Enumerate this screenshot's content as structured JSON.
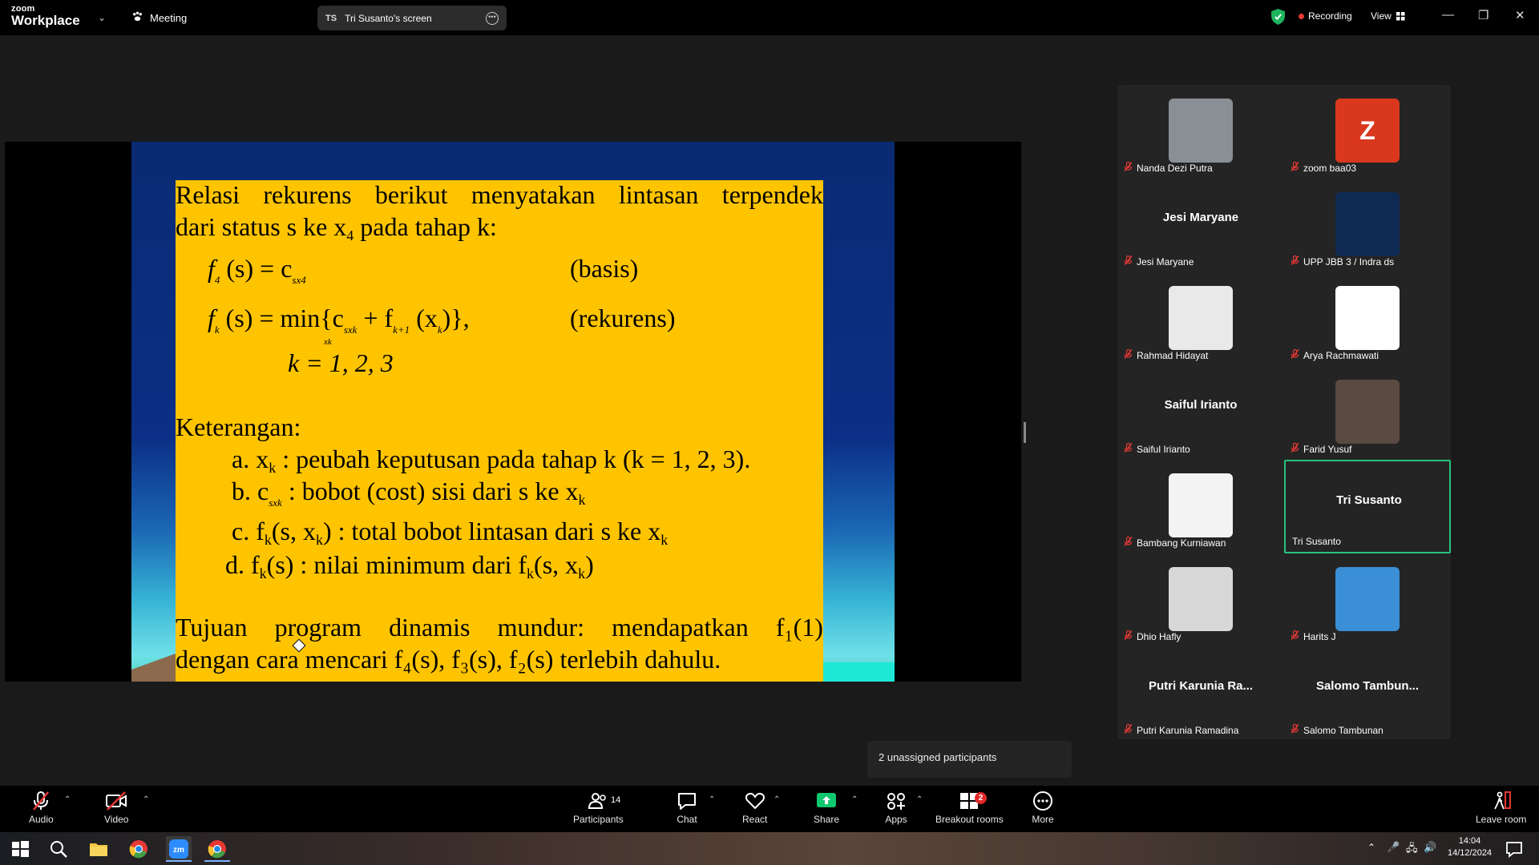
{
  "app": {
    "logo_top": "zoom",
    "logo_bottom": "Workplace",
    "meeting_label": "Meeting"
  },
  "screen_share": {
    "initials": "TS",
    "label": "Tri Susanto's screen"
  },
  "status": {
    "recording": "Recording",
    "view": "View"
  },
  "slide": {
    "line1": [
      "Relasi",
      "rekurens",
      "berikut",
      "menyatakan",
      "lintasan",
      "terpendek"
    ],
    "line2": "dari status s ke x",
    "line2_sub": "4",
    "line2_end": " pada tahap k:",
    "eq1": "f",
    "eq1_sub": "4",
    "eq1_rest": " (s) = c",
    "eq1_csub": "sx4",
    "basis": "(basis)",
    "eq2_a": "f",
    "eq2_ksub": "k",
    "eq2_b": " (s) = min{c",
    "eq2_csub": "sxk",
    "eq2_c": " + f",
    "eq2_fsub": "k+1",
    "eq2_d": " (x",
    "eq2_xsub": "k",
    "eq2_e": ")},",
    "eq2_min_sub": "xk",
    "rekurens": "(rekurens)",
    "eq3": "k = 1, 2, 3",
    "keterangan": "Keterangan:",
    "item_a": "a. x",
    "item_a_sub": "k",
    "item_a_rest": "  : peubah keputusan pada tahap k   (k = 1, 2, 3).",
    "item_b": "b.  c",
    "item_b_sub": "sxk",
    "item_b_rest": " : bobot (cost) sisi dari s ke x",
    "item_b_end_sub": "k",
    "item_c": "c.  f",
    "item_c_sub": "k",
    "item_c_rest": "(s, x",
    "item_c_sub2": "k",
    "item_c_end": ") : total bobot lintasan dari s ke x",
    "item_c_sub3": "k",
    "item_d": "d.  f",
    "item_d_sub": "k",
    "item_d_rest": "(s) : nilai minimum dari f",
    "item_d_sub2": "k",
    "item_d_end": "(s, x",
    "item_d_sub3": "k",
    "item_d_close": ")",
    "tujuan_words": [
      "Tujuan",
      "program",
      "dinamis",
      "mundur:",
      "mendapatkan",
      "f₁(1)"
    ],
    "last_line": "dengan cara mencari f₄(s), f₃(s), f₂(s) terlebih dahulu."
  },
  "participants": [
    {
      "name": "Nanda Dezi Putra",
      "kind": "photo",
      "color": "#8a8f96"
    },
    {
      "name": "zoom baa03",
      "kind": "letter",
      "letter": "Z"
    },
    {
      "name": "Jesi Maryane",
      "kind": "text",
      "display": "Jesi Maryane"
    },
    {
      "name": "UPP JBB 3 / Indra ds",
      "kind": "photo",
      "color": "#0f2a52"
    },
    {
      "name": "Rahmad Hidayat",
      "kind": "photo",
      "color": "#e9e9e9"
    },
    {
      "name": "Arya Rachmawati",
      "kind": "photo",
      "color": "#ffffff"
    },
    {
      "name": "Saiful Irianto",
      "kind": "text",
      "display": "Saiful Irianto"
    },
    {
      "name": "Farid Yusuf",
      "kind": "photo",
      "color": "#5a4a42"
    },
    {
      "name": "Bambang Kurniawan",
      "kind": "photo",
      "color": "#f3f3f3"
    },
    {
      "name": "Tri Susanto",
      "kind": "text",
      "display": "Tri Susanto"
    },
    {
      "name": "Dhio Hafly",
      "kind": "photo",
      "color": "#d8d8d8"
    },
    {
      "name": "Harits J",
      "kind": "photo",
      "color": "#3a8fd6"
    },
    {
      "name": "Putri Karunia Ramadina",
      "kind": "text",
      "display": "Putri Karunia Ra..."
    },
    {
      "name": "Salomo Tambunan",
      "kind": "text",
      "display": "Salomo  Tambun..."
    }
  ],
  "unassigned": "2 unassigned participants",
  "toolbar": {
    "audio": "Audio",
    "video": "Video",
    "participants": "Participants",
    "participants_count": "14",
    "chat": "Chat",
    "react": "React",
    "share": "Share",
    "apps": "Apps",
    "breakout": "Breakout rooms",
    "breakout_badge": "2",
    "more": "More",
    "leave": "Leave room"
  },
  "taskbar": {
    "time": "14:04",
    "date": "14/12/2024"
  },
  "colors": {
    "active_border": "#26c37c",
    "share_green": "#0ec86d",
    "slide_box": "#ffc400"
  }
}
